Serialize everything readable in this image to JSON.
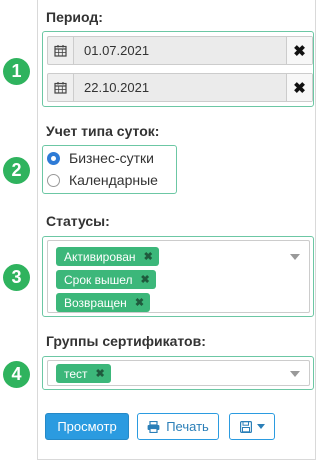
{
  "period": {
    "label": "Период:",
    "date_from": "01.07.2021",
    "date_to": "22.10.2021",
    "clear_symbol": "✖"
  },
  "day_type": {
    "label": "Учет типа суток:",
    "options": [
      {
        "label": "Бизнес-сутки",
        "checked": true
      },
      {
        "label": "Календарные",
        "checked": false
      }
    ]
  },
  "statuses": {
    "label": "Статусы:",
    "tags": [
      "Активирован",
      "Срок вышел",
      "Возвращен"
    ],
    "remove_symbol": "✖"
  },
  "cert_groups": {
    "label": "Группы сертификатов:",
    "tags": [
      "тест"
    ]
  },
  "buttons": {
    "view": "Просмотр",
    "print": "Печать"
  },
  "callouts": [
    "1",
    "2",
    "3",
    "4"
  ],
  "colors": {
    "accent_green": "#2fb35e",
    "tag_green": "#3cb77a",
    "primary_blue": "#2b9be0",
    "highlight_border": "#6cc7a4"
  }
}
